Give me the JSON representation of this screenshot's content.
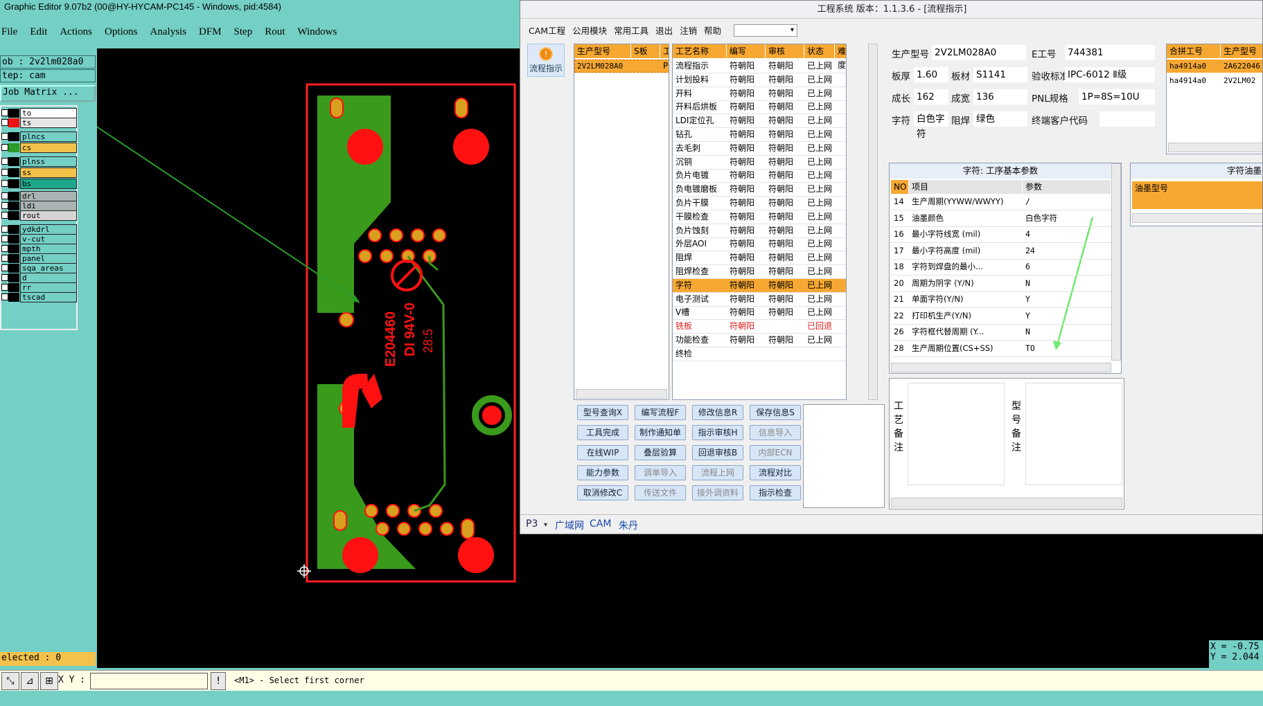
{
  "genesis": {
    "title": "Graphic Editor 9.07b2 (00@HY-HYCAM-PC145 - Windows, pid:4584)",
    "menu": [
      "File",
      "Edit",
      "Actions",
      "Options",
      "Analysis",
      "DFM",
      "Step",
      "Rout",
      "Windows"
    ],
    "job_label": "ob  : 2v2lm028a0",
    "step_label": "tep: cam",
    "job_matrix_button": "Job Matrix ...",
    "layers": [
      {
        "name": "to",
        "color": "#ffffff",
        "swatch": "#000000",
        "checked": true
      },
      {
        "name": "ts",
        "color": "#e6e6e6",
        "swatch": "#ee1111",
        "checked": true,
        "active": true
      },
      {
        "name": "plncs",
        "color": "#74cfc5",
        "swatch": "#000000"
      },
      {
        "name": "cs",
        "color": "#f3c24a",
        "swatch": "#2a9a2a"
      },
      {
        "name": "plnss",
        "color": "#74cfc5",
        "swatch": "#000000"
      },
      {
        "name": "ss",
        "color": "#f3c24a",
        "swatch": "#000000"
      },
      {
        "name": "bs",
        "color": "#1da88b",
        "swatch": "#000000"
      },
      {
        "name": "drl",
        "color": "#aab3b3",
        "swatch": "#000000"
      },
      {
        "name": "ldi",
        "color": "#aab3b3",
        "swatch": "#000000"
      },
      {
        "name": "rout",
        "color": "#d6d6d6",
        "swatch": "#000000"
      },
      {
        "name": "ydkdrl",
        "color": "#74cfc5",
        "swatch": "#000000"
      },
      {
        "name": "v-cut",
        "color": "#74cfc5",
        "swatch": "#000000"
      },
      {
        "name": "mpth",
        "color": "#74cfc5",
        "swatch": "#000000"
      },
      {
        "name": "panel",
        "color": "#74cfc5",
        "swatch": "#000000"
      },
      {
        "name": "sqa_areas",
        "color": "#74cfc5",
        "swatch": "#000000"
      },
      {
        "name": "d",
        "color": "#74cfc5",
        "swatch": "#000000"
      },
      {
        "name": "rr",
        "color": "#74cfc5",
        "swatch": "#000000"
      },
      {
        "name": "tscad",
        "color": "#74cfc5",
        "swatch": "#000000"
      }
    ],
    "selected": "elected : 0",
    "xy_label": "X Y :",
    "xy_value": "",
    "prompt": "<M1> - Select first corner",
    "coord_x": "X = -0.75",
    "coord_y": "Y = 2.044",
    "board_text": {
      "ul": "E204460",
      "rating": "DI 94V-0",
      "date": "28:5"
    },
    "colors": {
      "board_green": "#3a9a1c",
      "pad_red": "#ff1111",
      "pad_gold": "#d9a020",
      "outline": "#ff2020",
      "canvas": "#000000"
    }
  },
  "eng": {
    "title": "工程系统   版本：1.1.3.6 - [流程指示]",
    "menu": [
      "CAM工程",
      "公用模块",
      "常用工具",
      "退出",
      "注销",
      "帮助"
    ],
    "menu_combo": "▾",
    "flow_button": "流程指示",
    "model_table": {
      "headers": [
        "生产型号",
        "S板",
        "工"
      ],
      "rows": [
        [
          "2V2LM028A0",
          "P",
          ""
        ]
      ]
    },
    "process_table": {
      "headers": [
        "工艺名称",
        "编写",
        "审核",
        "状态",
        "难度"
      ],
      "rows": [
        [
          "流程指示",
          "符朝阳",
          "符朝阳",
          "已上网"
        ],
        [
          "计划投料",
          "符朝阳",
          "符朝阳",
          "已上网"
        ],
        [
          "开料",
          "符朝阳",
          "符朝阳",
          "已上网"
        ],
        [
          "开料后烘板",
          "符朝阳",
          "符朝阳",
          "已上网"
        ],
        [
          "LDI定位孔",
          "符朝阳",
          "符朝阳",
          "已上网"
        ],
        [
          "钻孔",
          "符朝阳",
          "符朝阳",
          "已上网"
        ],
        [
          "去毛刺",
          "符朝阳",
          "符朝阳",
          "已上网"
        ],
        [
          "沉铜",
          "符朝阳",
          "符朝阳",
          "已上网"
        ],
        [
          "负片电镀",
          "符朝阳",
          "符朝阳",
          "已上网"
        ],
        [
          "负电镀磨板",
          "符朝阳",
          "符朝阳",
          "已上网"
        ],
        [
          "负片干膜",
          "符朝阳",
          "符朝阳",
          "已上网"
        ],
        [
          "干膜检查",
          "符朝阳",
          "符朝阳",
          "已上网"
        ],
        [
          "负片蚀刻",
          "符朝阳",
          "符朝阳",
          "已上网"
        ],
        [
          "外层AOI",
          "符朝阳",
          "符朝阳",
          "已上网"
        ],
        [
          "阻焊",
          "符朝阳",
          "符朝阳",
          "已上网"
        ],
        [
          "阻焊检查",
          "符朝阳",
          "符朝阳",
          "已上网"
        ],
        [
          "字符",
          "符朝阳",
          "符朝阳",
          "已上网"
        ],
        [
          "电子测试",
          "符朝阳",
          "符朝阳",
          "已上网"
        ],
        [
          "V槽",
          "符朝阳",
          "符朝阳",
          "已上网"
        ],
        [
          "铣板",
          "符朝阳",
          "",
          "已回退"
        ],
        [
          "功能检查",
          "符朝阳",
          "符朝阳",
          "已上网"
        ],
        [
          "终检",
          "",
          "",
          ""
        ]
      ]
    },
    "buttons": [
      [
        "型号查询X",
        "编写流程F",
        "修改信息R",
        "保存信息S"
      ],
      [
        "工具完成",
        "制作通知单",
        "指示审核H",
        "信息导入"
      ],
      [
        "在线WIP",
        "叠层验算",
        "回退审核B",
        "内部ECN"
      ],
      [
        "能力参数",
        "调单导入",
        "流程上网",
        "流程对比"
      ],
      [
        "取消修改C",
        "传送文件",
        "接外调资料",
        "指示检查"
      ]
    ],
    "info": {
      "生产型号": "2V2LM028A0",
      "E工号": "744381",
      "板厚": "1.60",
      "板材": "S1141",
      "验收标准": "IPC-6012 Ⅱ级",
      "成长": "162",
      "成宽": "136",
      "PNL规格": "1P=8S=10U",
      "字符": "白色字符",
      "阻焊": "绿色",
      "终端客户代码": ""
    },
    "info_labels": {
      "model": "生产型号",
      "eno": "E工号",
      "thick": "板厚",
      "mat": "板材",
      "std": "验收标准",
      "len": "成长",
      "wid": "成宽",
      "pnl": "PNL规格",
      "char": "字符",
      "mask": "阻焊",
      "cust": "终端客户代码"
    },
    "merge_table": {
      "headers": [
        "合拼工号",
        "生产型号"
      ],
      "rows": [
        [
          "ha4914a0",
          "2A622046"
        ],
        [
          "ha4914a0",
          "2V2LM02"
        ]
      ]
    },
    "param_panel": {
      "title": "字符: 工序基本参数",
      "headers": [
        "NO",
        "项目",
        "参数"
      ],
      "rows": [
        [
          "14",
          "生产周期(YYWW/WWYY)",
          "/"
        ],
        [
          "15",
          "油墨颜色",
          "白色字符"
        ],
        [
          "16",
          "最小字符线宽 (mil)",
          "4"
        ],
        [
          "17",
          "最小字符高度 (mil)",
          "24"
        ],
        [
          "18",
          "字符到焊盘的最小...",
          "6"
        ],
        [
          "20",
          "周期为阴字 (Y/N)",
          "N"
        ],
        [
          "21",
          "单面字符(Y/N)",
          "Y"
        ],
        [
          "22",
          "打印机生产(Y/N)",
          "Y"
        ],
        [
          "26",
          "字符框代替周期 (Y...",
          "N"
        ],
        [
          "28",
          "生产周期位置(CS+SS)",
          "TO"
        ]
      ]
    },
    "ink_panel": {
      "title": "字符油墨",
      "header": "油墨型号"
    },
    "notes": {
      "process": "工艺备注",
      "model": "型号备注"
    },
    "status": {
      "sel": "P3",
      "net": "广域网",
      "cam": "CAM",
      "user": "朱丹"
    }
  }
}
